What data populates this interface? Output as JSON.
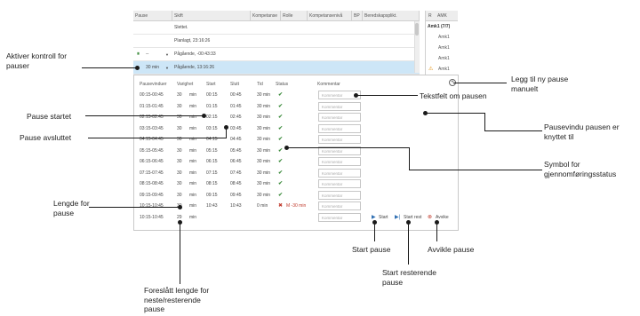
{
  "grid": {
    "headers": [
      "Pause",
      "Skift",
      "Kompetanse",
      "Rolle",
      "Kompetansenivå",
      "BP",
      "Beredskapsplikt."
    ],
    "rows": [
      {
        "text": "Slettet."
      },
      {
        "text": "Planlagt, 23:16:26"
      },
      {
        "prefix": "--",
        "text": "Pågående, -00:43:33"
      },
      {
        "prefix": "30 min",
        "text": "Pågående, 13:16:26"
      }
    ]
  },
  "right_panel": {
    "headers": [
      "R",
      "AMK"
    ],
    "rows": [
      "Amk1 (7/7)",
      "Amk1",
      "Amk1",
      "Amk1",
      "Amk1"
    ]
  },
  "pause_table": {
    "headers": [
      "Pausevinduer",
      "Varighet",
      "Start",
      "Slutt",
      "Tid",
      "Status",
      "Kommentar"
    ],
    "comment_placeholder": "Kommentar",
    "rows": [
      {
        "window": "00:15-00:45",
        "dur": "30",
        "unit": "min",
        "start": "00:15",
        "end": "00:45",
        "tid": "30 min",
        "status": "ok"
      },
      {
        "window": "01:15-01:45",
        "dur": "30",
        "unit": "min",
        "start": "01:15",
        "end": "01:45",
        "tid": "30 min",
        "status": "ok"
      },
      {
        "window": "02:15-02:45",
        "dur": "30",
        "unit": "min",
        "start": "02:15",
        "end": "02:45",
        "tid": "30 min",
        "status": "ok"
      },
      {
        "window": "03:15-03:45",
        "dur": "30",
        "unit": "min",
        "start": "03:15",
        "end": "03:45",
        "tid": "30 min",
        "status": "ok"
      },
      {
        "window": "04:15-04:45",
        "dur": "30",
        "unit": "min",
        "start": "04:15",
        "end": "04:45",
        "tid": "30 min",
        "status": "ok"
      },
      {
        "window": "05:15-05:45",
        "dur": "30",
        "unit": "min",
        "start": "05:15",
        "end": "05:45",
        "tid": "30 min",
        "status": "ok"
      },
      {
        "window": "06:15-06:45",
        "dur": "30",
        "unit": "min",
        "start": "06:15",
        "end": "06:45",
        "tid": "30 min",
        "status": "ok"
      },
      {
        "window": "07:15-07:45",
        "dur": "30",
        "unit": "min",
        "start": "07:15",
        "end": "07:45",
        "tid": "30 min",
        "status": "ok"
      },
      {
        "window": "08:15-08:45",
        "dur": "30",
        "unit": "min",
        "start": "08:15",
        "end": "08:45",
        "tid": "30 min",
        "status": "ok"
      },
      {
        "window": "09:15-09:45",
        "dur": "30",
        "unit": "min",
        "start": "09:15",
        "end": "09:45",
        "tid": "30 min",
        "status": "ok"
      },
      {
        "window": "10:15-10:45",
        "dur": "30",
        "unit": "min",
        "start": "10:43",
        "end": "10:43",
        "tid": "0 min",
        "status": "deviation",
        "status_text": "M -30 min"
      },
      {
        "window": "10:15-10:45",
        "dur": "29",
        "unit": "min",
        "start": "",
        "end": "",
        "tid": "",
        "status": "none"
      }
    ],
    "actions": {
      "start": "Start",
      "start_rest": "Start rest",
      "deviate": "Avvike"
    }
  },
  "annotations": {
    "aktiver": "Aktiver kontroll for\npauser",
    "pause_startet": "Pause startet",
    "pause_avsluttet": "Pause avsluttet",
    "lengde": "Lengde for\npause",
    "foreslatt": "Foreslått lengde for\nneste/resterende\npause",
    "legg_til": "Legg til ny pause\nmanuelt",
    "tekstfelt": "Tekstfelt om pausen",
    "pausevindu": "Pausevindu pausen er\nknyttet til",
    "symbol": "Symbol for\ngjennomføringsstatus",
    "start_pause": "Start pause",
    "start_resterende": "Start resterende\npause",
    "avvike": "Avvikle pause"
  },
  "colors": {
    "ok": "#3a8a3a",
    "deviation": "#c0392b",
    "action": "#2f6fb2",
    "selected_row": "#cde6f7"
  }
}
